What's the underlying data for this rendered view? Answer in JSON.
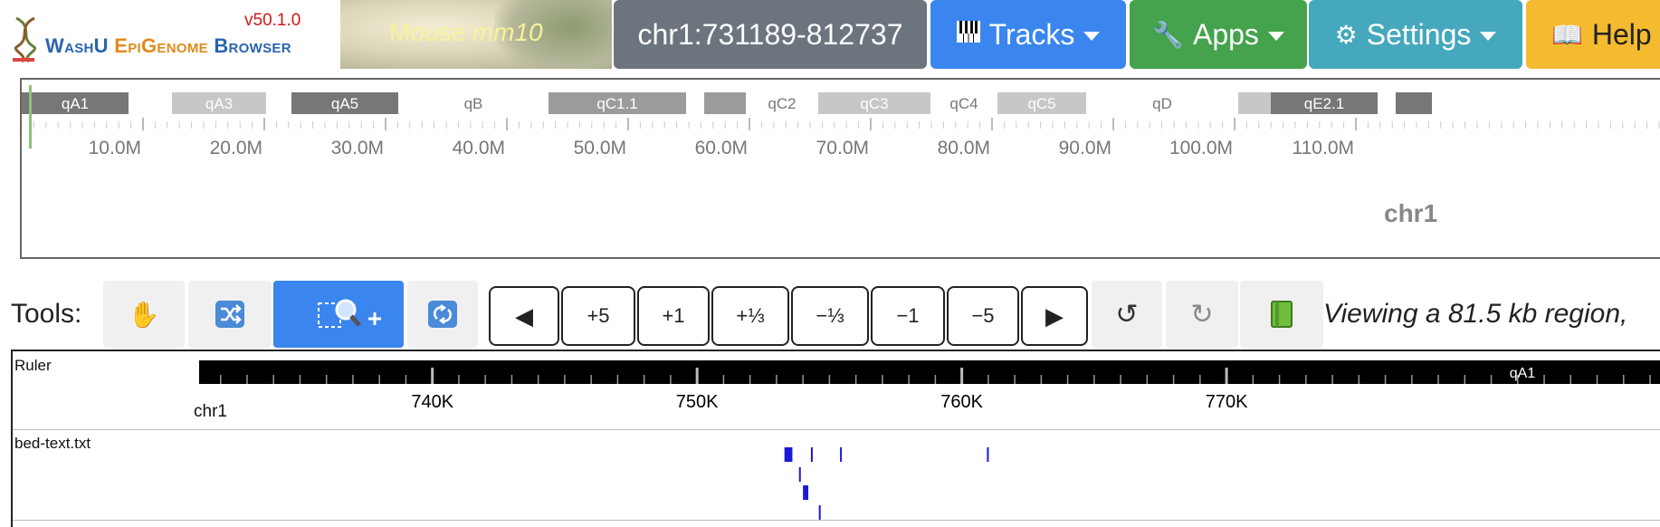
{
  "brand": {
    "version": "v50.1.0",
    "name_part1": "WashU ",
    "name_part2": "EpiGenome",
    "name_part3": " Browser"
  },
  "genome": {
    "species": "Mouse",
    "assembly": "mm10"
  },
  "nav": {
    "locus": "chr1:731189-812737",
    "tracks": "Tracks",
    "apps": "Apps",
    "settings": "Settings",
    "help": "Help",
    "icons": {
      "tracks": "piano-keys-icon",
      "apps": "wrench-icon",
      "settings": "gear-icon",
      "help": "book-icon"
    }
  },
  "ideogram": {
    "chromosome": "chr1",
    "bands": [
      {
        "name": "qA1",
        "shade": "dark"
      },
      {
        "name": "",
        "shade": "white"
      },
      {
        "name": "qA3",
        "shade": "light"
      },
      {
        "name": "",
        "shade": "white"
      },
      {
        "name": "qA5",
        "shade": "dark"
      },
      {
        "name": "qB",
        "shade": "white"
      },
      {
        "name": "qC1.1",
        "shade": "medium"
      },
      {
        "name": "",
        "shade": "white"
      },
      {
        "name": "",
        "shade": "medium"
      },
      {
        "name": "qC2",
        "shade": "white"
      },
      {
        "name": "qC3",
        "shade": "light"
      },
      {
        "name": "qC4",
        "shade": "white"
      },
      {
        "name": "qC5",
        "shade": "light"
      },
      {
        "name": "qD",
        "shade": "white"
      },
      {
        "name": "",
        "shade": "light"
      },
      {
        "name": "qE2.1",
        "shade": "dark"
      },
      {
        "name": "",
        "shade": "white"
      },
      {
        "name": "",
        "shade": "dark"
      }
    ],
    "tick_labels": [
      "10.0M",
      "20.0M",
      "30.0M",
      "40.0M",
      "50.0M",
      "60.0M",
      "70.0M",
      "80.0M",
      "90.0M",
      "100.0M",
      "110.0M"
    ]
  },
  "tools": {
    "label": "Tools:",
    "items": [
      {
        "name": "drag-tool",
        "icon": "hand-icon",
        "active": false
      },
      {
        "name": "reorder-tool",
        "icon": "shuffle-icon",
        "active": false
      },
      {
        "name": "zoom-region-tool",
        "icon": "magnify-select-icon",
        "active": true
      },
      {
        "name": "rotate-tool",
        "icon": "refresh-icon",
        "active": false
      }
    ],
    "nav_steps": [
      "◀",
      "+5",
      "+1",
      "+⅓",
      "−⅓",
      "−1",
      "−5",
      "▶"
    ],
    "undo_icon": "undo-icon",
    "redo_icon": "redo-icon",
    "book_icon": "book-icon",
    "viewing_text": "Viewing a 81.5 kb region,"
  },
  "tracks": {
    "ruler": {
      "label": "Ruler",
      "chrom": "chr1",
      "band": "qA1",
      "ticks": [
        "740K",
        "750K",
        "760K",
        "770K"
      ]
    },
    "bed": {
      "label": "bed-text.txt",
      "features": [
        {
          "start": 753.3,
          "end": 753.6,
          "row": 0
        },
        {
          "start": 754.3,
          "end": 754.35,
          "row": 0
        },
        {
          "start": 755.4,
          "end": 755.45,
          "row": 0
        },
        {
          "start": 760.95,
          "end": 761.0,
          "row": 0
        },
        {
          "start": 753.85,
          "end": 753.9,
          "row": 1
        },
        {
          "start": 754.0,
          "end": 754.2,
          "row": 2
        },
        {
          "start": 754.6,
          "end": 754.65,
          "row": 3
        }
      ]
    }
  },
  "colors": {
    "accent_blue": "#3a86ee",
    "feature_blue": "#1a1ad6",
    "apps_green": "#44a34c",
    "settings_teal": "#45a8bd",
    "help_yellow": "#f4ba30",
    "locus_gray": "#6c757d"
  }
}
